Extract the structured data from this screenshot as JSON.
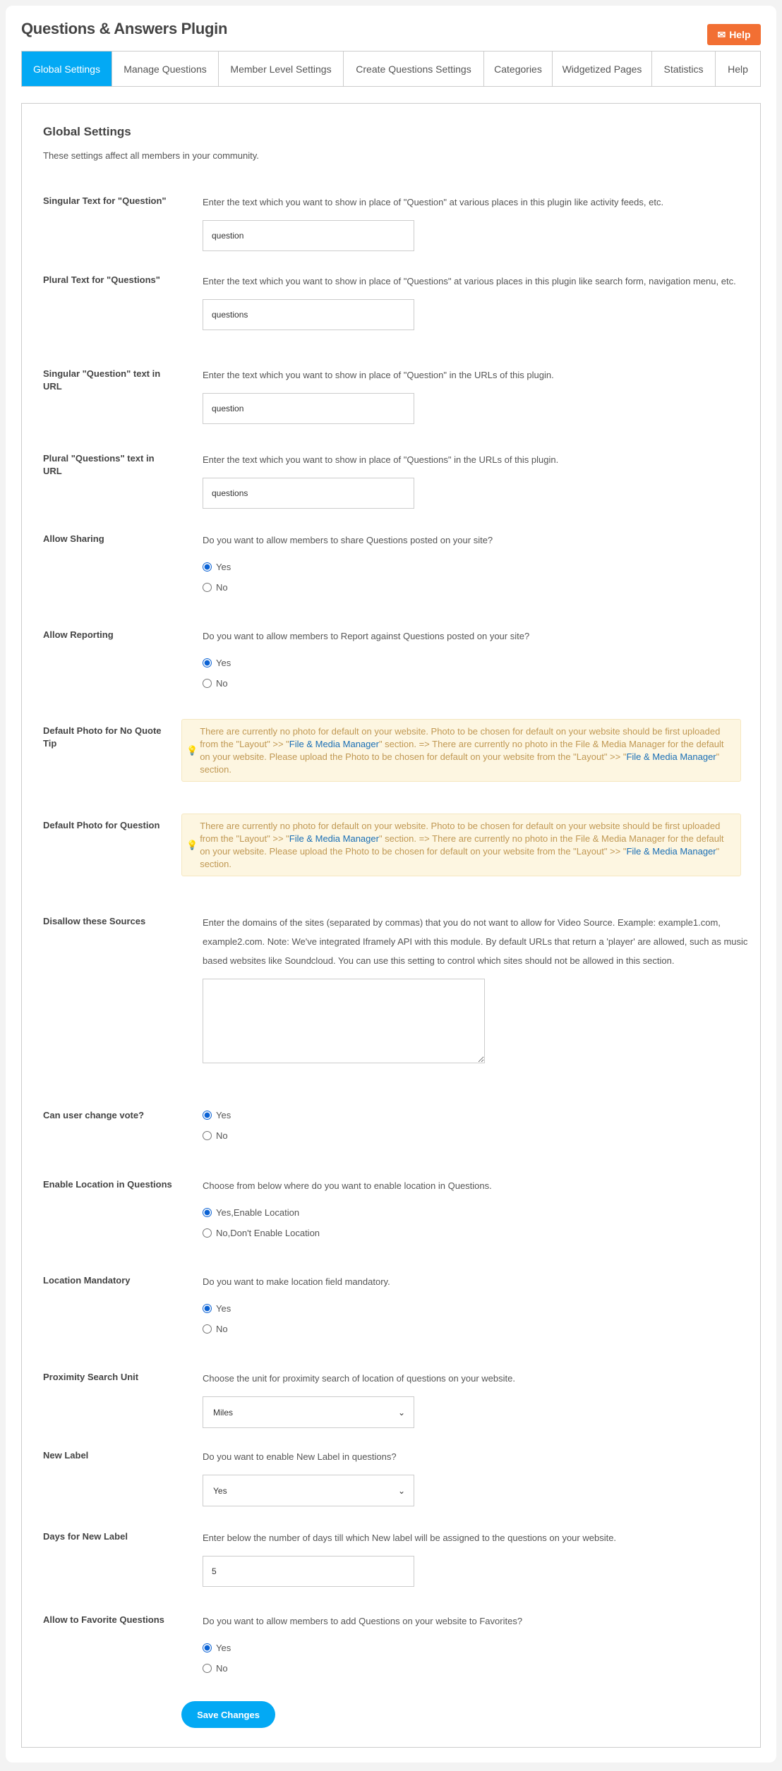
{
  "header": {
    "title": "Questions & Answers Plugin",
    "help_label": "Help"
  },
  "tabs": [
    {
      "label": "Global Settings"
    },
    {
      "label": "Manage Questions"
    },
    {
      "label": "Member Level Settings"
    },
    {
      "label": "Create Questions Settings"
    },
    {
      "label": "Categories"
    },
    {
      "label": "Widgetized Pages"
    },
    {
      "label": "Statistics"
    },
    {
      "label": "Help"
    }
  ],
  "form": {
    "title": "Global Settings",
    "intro": "These settings affect all members in your community.",
    "singular": {
      "label": "Singular Text for \"Question\"",
      "desc": "Enter the text which you want to show in place of \"Question\" at various places in this plugin like activity feeds, etc.",
      "value": "question"
    },
    "plural": {
      "label": "Plural Text for \"Questions\"",
      "desc": "Enter the text which you want to show in place of \"Questions\" at various places in this plugin like search form, navigation menu, etc.",
      "value": "questions"
    },
    "singular_url": {
      "label": "Singular \"Question\" text in URL",
      "desc": "Enter the text which you want to show in place of \"Question\" in the URLs of this plugin.",
      "value": "question"
    },
    "plural_url": {
      "label": "Plural \"Questions\" text in URL",
      "desc": "Enter the text which you want to show in place of \"Questions\" in the URLs of this plugin.",
      "value": "questions"
    },
    "sharing": {
      "label": "Allow Sharing",
      "desc": "Do you want to allow members to share Questions posted on your site?",
      "options": [
        "Yes",
        "No"
      ],
      "selected": "Yes"
    },
    "reporting": {
      "label": "Allow Reporting",
      "desc": "Do you want to allow members to Report against Questions posted on your site?",
      "options": [
        "Yes",
        "No"
      ],
      "selected": "Yes"
    },
    "tip_text": {
      "p1": "There are currently no photo for default on your website. Photo to be chosen for default on your website should be first uploaded from the \"Layout\" >> \"",
      "link": "File & Media Manager",
      "p2": "\" section. => There are currently no photo in the File & Media Manager for the default on your website. Please upload the Photo to be chosen for default on your website from the \"Layout\" >> \"",
      "p3": "\" section."
    },
    "photo_no_quote": {
      "label": "Default Photo for No Quote Tip"
    },
    "photo_question": {
      "label": "Default Photo for Question"
    },
    "disallow": {
      "label": "Disallow these Sources",
      "desc": "Enter the domains of the sites (separated by commas) that you do not want to allow for Video Source. Example: example1.com, example2.com. Note: We've integrated Iframely API with this module. By default URLs that return a 'player' are allowed, such as music based websites like Soundcloud. You can use this setting to control which sites should not be allowed in this section.",
      "value": ""
    },
    "vote": {
      "label": "Can user change vote?",
      "options": [
        "Yes",
        "No"
      ],
      "selected": "Yes"
    },
    "location": {
      "label": "Enable Location in Questions",
      "desc": "Choose from below where do you want to enable location in Questions.",
      "options": [
        "Yes,Enable Location",
        "No,Don't Enable Location"
      ],
      "selected": "Yes,Enable Location"
    },
    "location_mandatory": {
      "label": "Location Mandatory",
      "desc": "Do you want to make location field mandatory.",
      "options": [
        "Yes",
        "No"
      ],
      "selected": "Yes"
    },
    "proximity": {
      "label": "Proximity Search Unit",
      "desc": "Choose the unit for proximity search of location of questions on your website.",
      "value": "Miles"
    },
    "new_label": {
      "label": "New Label",
      "desc": "Do you want to enable New Label in questions?",
      "value": "Yes"
    },
    "days": {
      "label": "Days for New Label",
      "desc": "Enter below the number of days till which New label will be assigned to the questions on your website.",
      "value": "5"
    },
    "favorite": {
      "label": "Allow to Favorite Questions",
      "desc": "Do you want to allow members to add Questions on your website to Favorites?",
      "options": [
        "Yes",
        "No"
      ],
      "selected": "Yes"
    },
    "save_label": "Save Changes"
  },
  "colors": {
    "accent": "#03a9f4",
    "help": "#f26f33",
    "tip_bg": "#fdf6e1",
    "tip_text": "#c09853",
    "link": "#1a6fb5"
  }
}
